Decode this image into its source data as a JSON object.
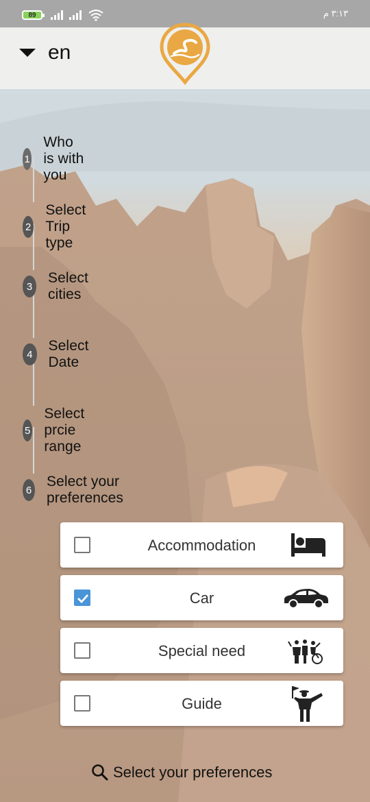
{
  "status_bar": {
    "battery": "89",
    "time": "٣:١٣ م"
  },
  "header": {
    "language": "en",
    "logo_icon": "location-pin-logo-icon"
  },
  "steps": [
    {
      "number": "1",
      "label": "Who is with you"
    },
    {
      "number": "2",
      "label": "Select Trip type"
    },
    {
      "number": "3",
      "label": "Select cities"
    },
    {
      "number": "4",
      "label": "Select Date"
    },
    {
      "number": "5",
      "label": "Select prcie range"
    },
    {
      "number": "6",
      "label": "Select your preferences"
    }
  ],
  "preferences": [
    {
      "label": "Accommodation",
      "checked": false,
      "icon": "bed-icon"
    },
    {
      "label": "Car",
      "checked": true,
      "icon": "car-icon"
    },
    {
      "label": "Special need",
      "checked": false,
      "icon": "special-need-icon"
    },
    {
      "label": "Guide",
      "checked": false,
      "icon": "guide-icon"
    }
  ],
  "action": {
    "label": "Select your preferences",
    "icon": "search-icon"
  },
  "colors": {
    "accent_gold": "#e9a843",
    "check_blue": "#4a94d8",
    "step_circle": "#555555"
  }
}
